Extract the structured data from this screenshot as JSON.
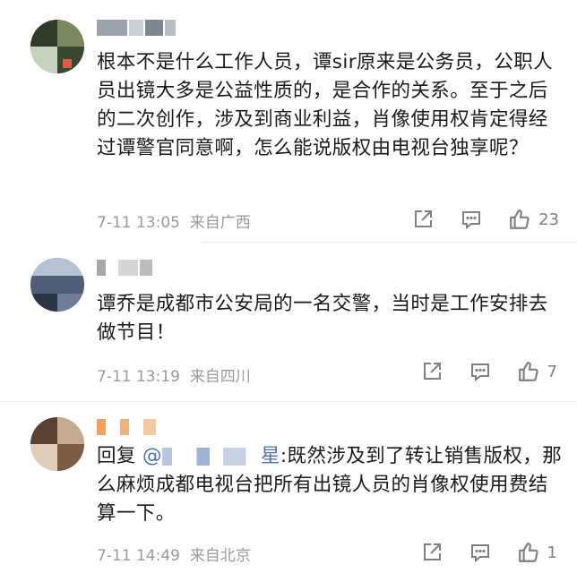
{
  "comments": [
    {
      "text": "根本不是什么工作人员，谭sir原来是公务员，公职人员出镜大多是公益性质的，是合作的关系。至于之后的二次创作，涉及到商业利益，肖像使用权肯定得经过谭警官同意啊，怎么能说版权由电视台独享呢？",
      "time": "7-11 13:05",
      "location": "来自广西",
      "likes": "23"
    },
    {
      "text": "谭乔是成都市公安局的一名交警，当时是工作安排去做节目！",
      "time": "7-11 13:19",
      "location": "来自四川",
      "likes": "7"
    },
    {
      "reply_prefix": "回复",
      "mention_at": "@",
      "mention_suffix": "星",
      "text": ":既然涉及到了转让销售版权，那么麻烦成都电视台把所有出镜人员的肖像权使用费结算一下。",
      "time": "7-11 14:49",
      "location": "来自北京",
      "likes": "1"
    }
  ],
  "icons": {
    "share": "share-icon",
    "comment": "comment-icon",
    "like": "thumbs-up-icon"
  },
  "colors": {
    "text": "#1a1a1a",
    "meta": "#9a9a9a",
    "icon": "#808080",
    "mention": "#4b6ea8"
  }
}
